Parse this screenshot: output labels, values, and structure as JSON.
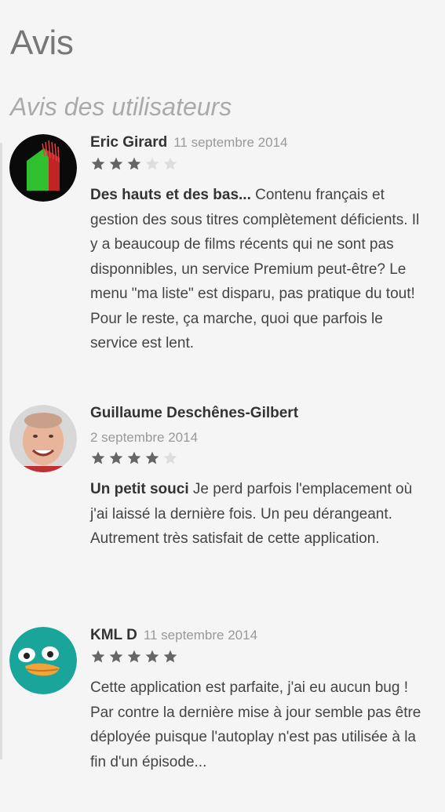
{
  "page": {
    "title": "Avis",
    "section_title": "Avis des utilisateurs"
  },
  "colors": {
    "star_filled": "#666666",
    "star_empty": "#dddddd"
  },
  "reviews": [
    {
      "author": "Eric Girard",
      "date": "11 septembre 2014",
      "rating": 3,
      "max_rating": 5,
      "title": "Des hauts et des bas...",
      "body": "Contenu français et gestion des sous titres complètement déficients. Il y a beaucoup de films récents qui ne sont pas disponnibles, un service Premium peut-être? Le menu \"ma liste\" est disparu, pas pratique du tout! Pour le reste, ça marche, quoi que parfois le service est lent."
    },
    {
      "author": "Guillaume Deschênes-Gilbert",
      "date": "2 septembre 2014",
      "rating": 4,
      "max_rating": 5,
      "title": "Un petit souci",
      "body": "Je perd parfois l'emplacement où j'ai laissé la dernière fois. Un peu dérangeant. Autrement très satisfait de cette application."
    },
    {
      "author": "KML D",
      "date": "11 septembre 2014",
      "rating": 5,
      "max_rating": 5,
      "title": "",
      "body": "Cette application est parfaite, j'ai eu aucun bug ! Par contre la dernière mise à jour semble pas être déployée puisque l'autoplay n'est pas utilisée à la fin d'un épisode..."
    }
  ]
}
